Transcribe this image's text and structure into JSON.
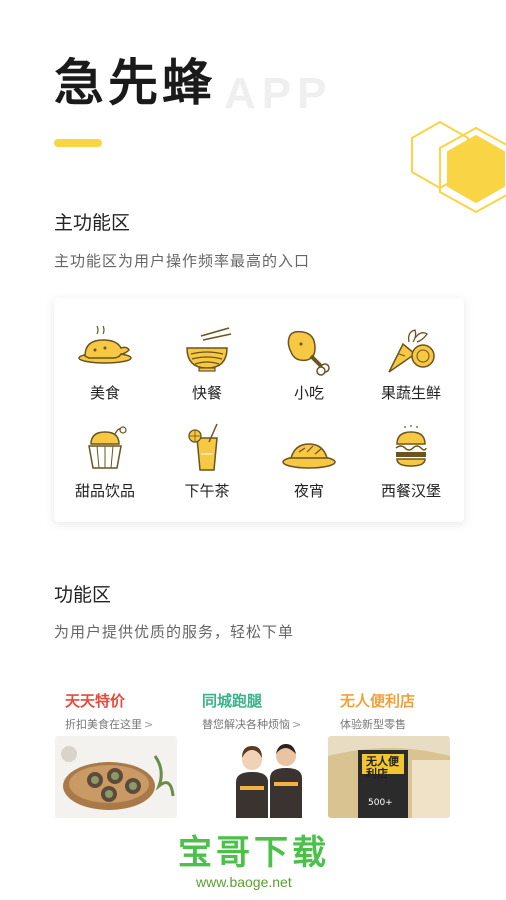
{
  "header": {
    "title": "急先蜂",
    "subtitle": "APP"
  },
  "main_section": {
    "title": "主功能区",
    "description": "主功能区为用户操作频率最高的入口"
  },
  "categories": [
    {
      "label": "美食",
      "icon": "roast-chicken-icon"
    },
    {
      "label": "快餐",
      "icon": "noodle-bowl-icon"
    },
    {
      "label": "小吃",
      "icon": "drumstick-icon"
    },
    {
      "label": "果蔬生鲜",
      "icon": "fruit-vegetable-icon"
    },
    {
      "label": "甜品饮品",
      "icon": "cupcake-icon"
    },
    {
      "label": "下午茶",
      "icon": "lemon-drink-icon"
    },
    {
      "label": "夜宵",
      "icon": "night-snack-icon"
    },
    {
      "label": "西餐汉堡",
      "icon": "burger-icon"
    }
  ],
  "feature_section": {
    "title": "功能区",
    "description": "为用户提供优质的服务，轻松下单"
  },
  "promos": [
    {
      "title": "天天特价",
      "subtitle": "折扣美食在这里",
      "chevron": ">",
      "color": "#e84a3c"
    },
    {
      "title": "同城跑腿",
      "subtitle": "替您解决各种烦恼",
      "chevron": ">",
      "color": "#3cb38a"
    },
    {
      "title": "无人便利店",
      "subtitle": "体验新型零售",
      "chevron": "",
      "color": "#f0a23a"
    }
  ],
  "store_sign": {
    "name": "无人便利店",
    "count": "500+"
  },
  "watermark": {
    "text": "宝哥下载",
    "url": "www.baoge.net"
  },
  "colors": {
    "accent": "#f9d445",
    "icon_fill": "#f7c843",
    "icon_stroke": "#6b5420"
  }
}
